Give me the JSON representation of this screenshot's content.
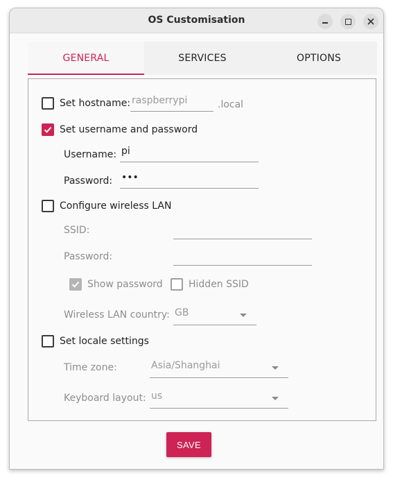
{
  "window": {
    "title": "OS Customisation"
  },
  "tabs": [
    {
      "label": "GENERAL",
      "active": true
    },
    {
      "label": "SERVICES",
      "active": false
    },
    {
      "label": "OPTIONS",
      "active": false
    }
  ],
  "hostname": {
    "label": "Set hostname:",
    "placeholder": "raspberrypi",
    "suffix": ".local",
    "checked": false
  },
  "user": {
    "label": "Set username and password",
    "checked": true,
    "username_label": "Username:",
    "username_value": "pi",
    "password_label": "Password:",
    "password_value": "•••"
  },
  "wireless": {
    "label": "Configure wireless LAN",
    "checked": false,
    "ssid_label": "SSID:",
    "password_label": "Password:",
    "show_password_label": "Show password",
    "show_password_checked": true,
    "hidden_ssid_label": "Hidden SSID",
    "hidden_ssid_checked": false,
    "country_label": "Wireless LAN country:",
    "country_value": "GB"
  },
  "locale": {
    "label": "Set locale settings",
    "checked": false,
    "timezone_label": "Time zone:",
    "timezone_value": "Asia/Shanghai",
    "keyboard_label": "Keyboard layout:",
    "keyboard_value": "us"
  },
  "actions": {
    "save_label": "SAVE"
  },
  "colors": {
    "accent": "#cd2355"
  }
}
